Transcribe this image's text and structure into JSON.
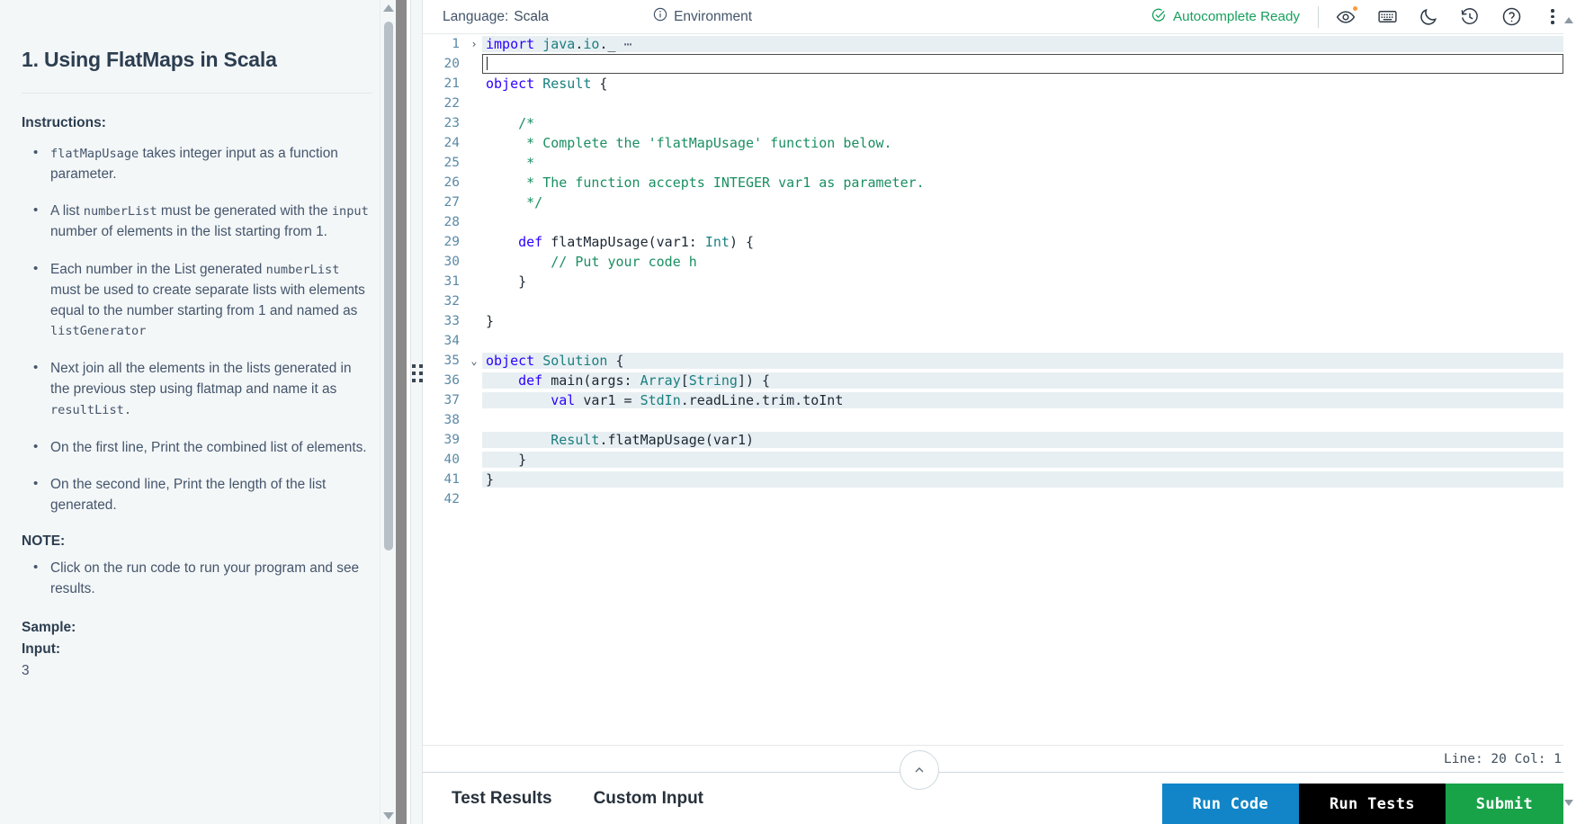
{
  "left_panel": {
    "title": "1. Using FlatMaps in Scala",
    "instructions_heading": "Instructions:",
    "instructions": [
      {
        "parts": [
          {
            "t": "code",
            "v": "flatMapUsage"
          },
          {
            "t": "text",
            "v": " takes integer input as a function parameter."
          }
        ]
      },
      {
        "parts": [
          {
            "t": "text",
            "v": "A list "
          },
          {
            "t": "code",
            "v": "numberList"
          },
          {
            "t": "text",
            "v": " must be generated with the "
          },
          {
            "t": "code",
            "v": "input"
          },
          {
            "t": "text",
            "v": " number of elements in the list starting from 1."
          }
        ]
      },
      {
        "parts": [
          {
            "t": "text",
            "v": "Each number in the List generated "
          },
          {
            "t": "code",
            "v": "numberList"
          },
          {
            "t": "text",
            "v": " must be used to create separate lists with elements equal to the number starting from 1 and named as "
          },
          {
            "t": "code",
            "v": "listGenerator"
          }
        ]
      },
      {
        "parts": [
          {
            "t": "text",
            "v": "Next join all the elements in the lists generated in the previous step using flatmap and name it as "
          },
          {
            "t": "code",
            "v": "resultList."
          }
        ]
      },
      {
        "parts": [
          {
            "t": "text",
            "v": "On the first line, Print the combined list of elements."
          }
        ]
      },
      {
        "parts": [
          {
            "t": "text",
            "v": "On the second line, Print the length of the list generated."
          }
        ]
      }
    ],
    "note_heading": "NOTE:",
    "notes": [
      {
        "parts": [
          {
            "t": "text",
            "v": "Click on the run code to run your program and see results."
          }
        ]
      }
    ],
    "sample_label": "Sample:",
    "input_label": "Input:",
    "input_value": "3"
  },
  "toolbar": {
    "language_label": "Language:",
    "language_value": "Scala",
    "environment_label": "Environment",
    "environment_icon": "info-circle-icon",
    "autocomplete_status": "Autocomplete Ready",
    "autocomplete_icon": "check-circle-icon",
    "autocomplete_color": "#17a05e",
    "icons": [
      {
        "name": "eye-icon",
        "has_badge": true
      },
      {
        "name": "keyboard-icon",
        "has_badge": false
      },
      {
        "name": "moon-icon",
        "has_badge": false
      },
      {
        "name": "history-icon",
        "has_badge": false
      },
      {
        "name": "help-circle-icon",
        "has_badge": false
      },
      {
        "name": "more-options-icon",
        "has_badge": false
      }
    ]
  },
  "editor": {
    "lines": [
      {
        "num": "1",
        "fold": "collapsed",
        "state": "collapsed",
        "tokens": [
          {
            "c": "kw",
            "v": "import"
          },
          {
            "c": "plain",
            "v": " "
          },
          {
            "c": "typ",
            "v": "java"
          },
          {
            "c": "plain",
            "v": "."
          },
          {
            "c": "typ",
            "v": "io"
          },
          {
            "c": "plain",
            "v": "._"
          },
          {
            "c": "dots",
            "v": " ⋯"
          }
        ]
      },
      {
        "num": "20",
        "fold": "",
        "state": "active",
        "tokens": []
      },
      {
        "num": "21",
        "fold": "",
        "state": "",
        "tokens": [
          {
            "c": "kw",
            "v": "object"
          },
          {
            "c": "plain",
            "v": " "
          },
          {
            "c": "typ",
            "v": "Result"
          },
          {
            "c": "plain",
            "v": " {"
          }
        ]
      },
      {
        "num": "22",
        "fold": "",
        "state": "",
        "tokens": []
      },
      {
        "num": "23",
        "fold": "",
        "state": "",
        "tokens": [
          {
            "c": "cmt",
            "v": "    /*"
          }
        ]
      },
      {
        "num": "24",
        "fold": "",
        "state": "",
        "tokens": [
          {
            "c": "cmt",
            "v": "     * Complete the 'flatMapUsage' function below."
          }
        ]
      },
      {
        "num": "25",
        "fold": "",
        "state": "",
        "tokens": [
          {
            "c": "cmt",
            "v": "     *"
          }
        ]
      },
      {
        "num": "26",
        "fold": "",
        "state": "",
        "tokens": [
          {
            "c": "cmt",
            "v": "     * The function accepts INTEGER var1 as parameter."
          }
        ]
      },
      {
        "num": "27",
        "fold": "",
        "state": "",
        "tokens": [
          {
            "c": "cmt",
            "v": "     */"
          }
        ]
      },
      {
        "num": "28",
        "fold": "",
        "state": "",
        "tokens": []
      },
      {
        "num": "29",
        "fold": "",
        "state": "",
        "tokens": [
          {
            "c": "plain",
            "v": "    "
          },
          {
            "c": "kw",
            "v": "def"
          },
          {
            "c": "plain",
            "v": " flatMapUsage(var1: "
          },
          {
            "c": "typ",
            "v": "Int"
          },
          {
            "c": "plain",
            "v": ") {"
          }
        ]
      },
      {
        "num": "30",
        "fold": "",
        "state": "",
        "tokens": [
          {
            "c": "plain",
            "v": "       "
          },
          {
            "c": "cmt",
            "v": " // Put your code h"
          }
        ]
      },
      {
        "num": "31",
        "fold": "",
        "state": "",
        "tokens": [
          {
            "c": "plain",
            "v": "    }"
          }
        ]
      },
      {
        "num": "32",
        "fold": "",
        "state": "",
        "tokens": []
      },
      {
        "num": "33",
        "fold": "",
        "state": "",
        "tokens": [
          {
            "c": "plain",
            "v": "}"
          }
        ]
      },
      {
        "num": "34",
        "fold": "",
        "state": "",
        "tokens": []
      },
      {
        "num": "35",
        "fold": "expanded",
        "state": "readonly",
        "tokens": [
          {
            "c": "kw",
            "v": "object"
          },
          {
            "c": "plain",
            "v": " "
          },
          {
            "c": "typ",
            "v": "Solution"
          },
          {
            "c": "plain",
            "v": " {"
          }
        ]
      },
      {
        "num": "36",
        "fold": "",
        "state": "readonly",
        "tokens": [
          {
            "c": "plain",
            "v": "    "
          },
          {
            "c": "kw",
            "v": "def"
          },
          {
            "c": "plain",
            "v": " main(args: "
          },
          {
            "c": "typ",
            "v": "Array"
          },
          {
            "c": "plain",
            "v": "["
          },
          {
            "c": "typ",
            "v": "String"
          },
          {
            "c": "plain",
            "v": "]) {"
          }
        ]
      },
      {
        "num": "37",
        "fold": "",
        "state": "readonly",
        "tokens": [
          {
            "c": "plain",
            "v": "        "
          },
          {
            "c": "kw",
            "v": "val"
          },
          {
            "c": "plain",
            "v": " var1 = "
          },
          {
            "c": "typ",
            "v": "StdIn"
          },
          {
            "c": "plain",
            "v": ".readLine.trim.toInt"
          }
        ]
      },
      {
        "num": "38",
        "fold": "",
        "state": "readonly",
        "tokens": []
      },
      {
        "num": "39",
        "fold": "",
        "state": "readonly",
        "tokens": [
          {
            "c": "plain",
            "v": "        "
          },
          {
            "c": "typ",
            "v": "Result"
          },
          {
            "c": "plain",
            "v": ".flatMapUsage(var1)"
          }
        ]
      },
      {
        "num": "40",
        "fold": "",
        "state": "readonly",
        "tokens": [
          {
            "c": "plain",
            "v": "    }"
          }
        ]
      },
      {
        "num": "41",
        "fold": "",
        "state": "readonly",
        "tokens": [
          {
            "c": "plain",
            "v": "}"
          }
        ]
      },
      {
        "num": "42",
        "fold": "",
        "state": "readonly",
        "tokens": []
      }
    ]
  },
  "status": {
    "cursor_position": "Line: 20 Col: 1"
  },
  "results_panel": {
    "tabs": [
      {
        "label": "Test Results",
        "active": true
      },
      {
        "label": "Custom Input",
        "active": false
      }
    ],
    "collapse_icon": "chevron-up-icon"
  },
  "actions": {
    "run_code": "Run Code",
    "run_tests": "Run Tests",
    "submit": "Submit",
    "run_code_color": "#1285c8",
    "run_tests_color": "#000000",
    "submit_color": "#18a349"
  }
}
